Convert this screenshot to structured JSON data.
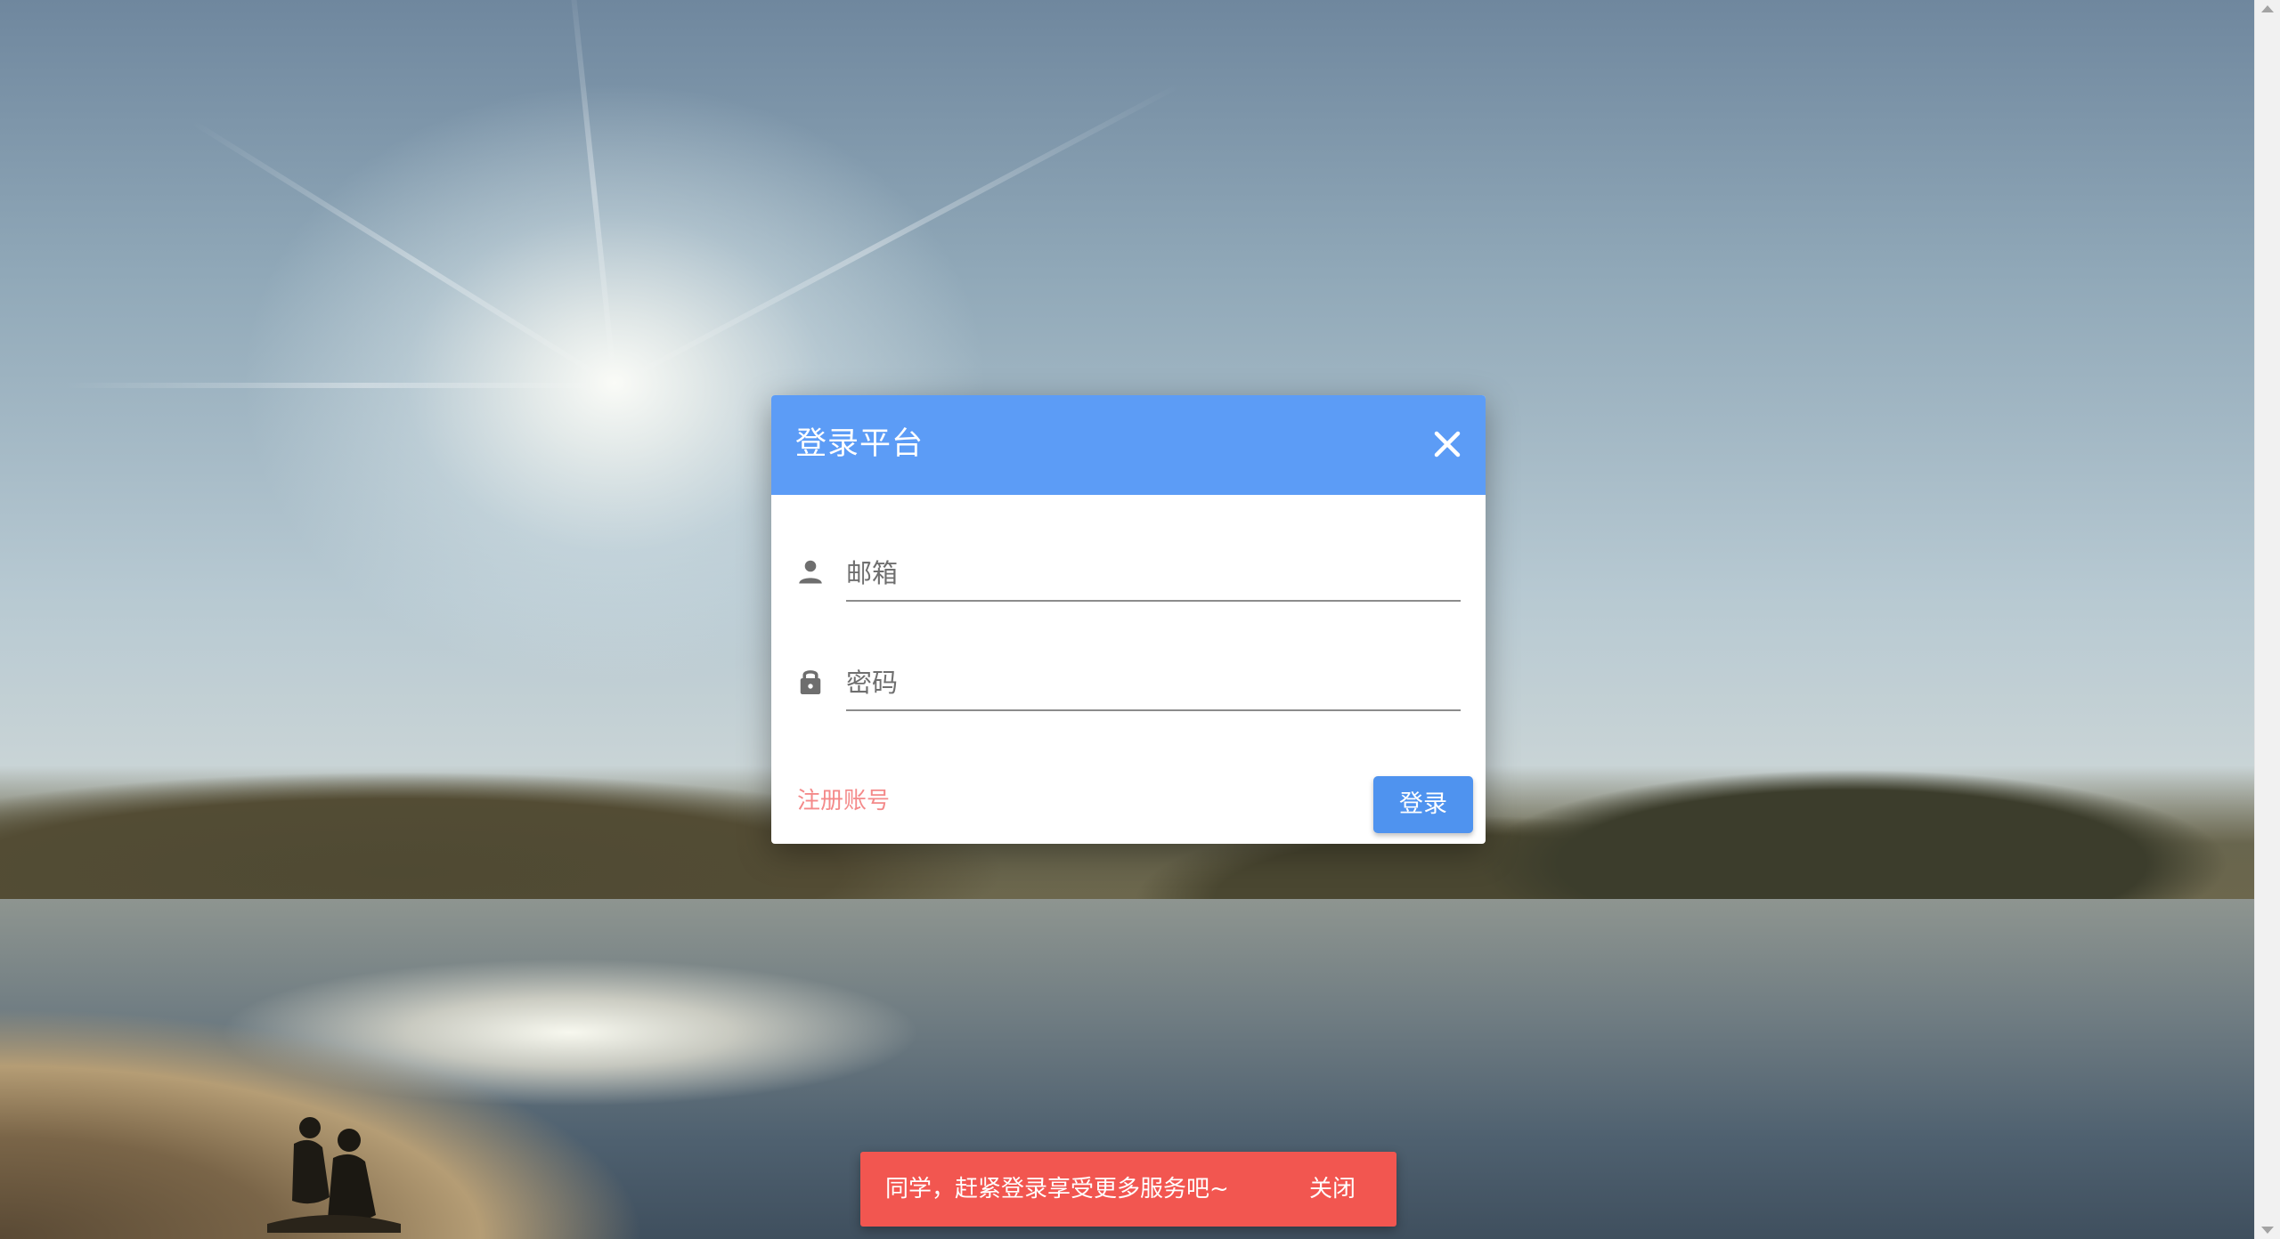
{
  "dialog": {
    "title": "登录平台",
    "email_placeholder": "邮箱",
    "password_placeholder": "密码",
    "register_link": "注册账号",
    "login_button": "登录",
    "header_color": "#5c9cf6"
  },
  "snackbar": {
    "message": "同学，赶紧登录享受更多服务吧~",
    "close_label": "关闭",
    "color": "#f25650"
  },
  "icons": {
    "close": "close-icon",
    "email": "person-icon",
    "password": "lock-icon"
  }
}
